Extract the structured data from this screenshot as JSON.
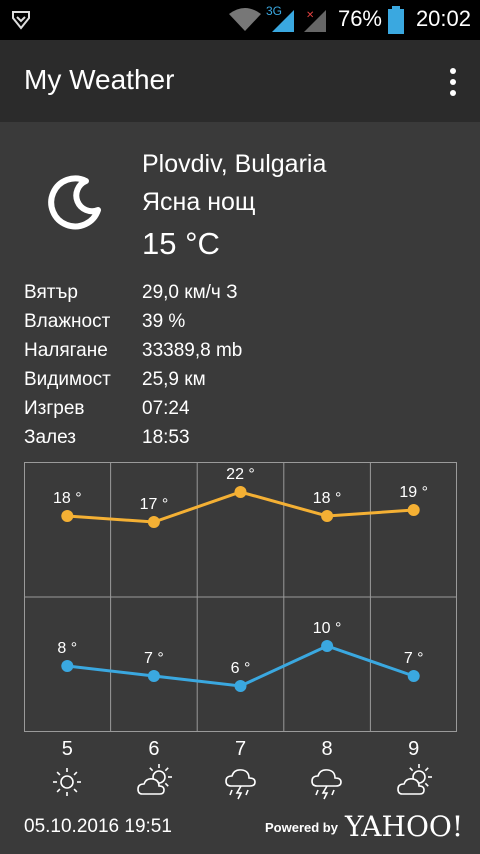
{
  "status_bar": {
    "battery_pct": "76%",
    "time": "20:02",
    "network": "3G"
  },
  "app": {
    "title": "My Weather"
  },
  "current": {
    "location": "Plovdiv, Bulgaria",
    "condition": "Ясна нощ",
    "temperature": "15 °C",
    "icon": "moon-icon"
  },
  "details": [
    {
      "label": "Вятър",
      "value": "29,0 км/ч З"
    },
    {
      "label": "Влажност",
      "value": "39 %"
    },
    {
      "label": "Налягане",
      "value": "33389,8 mb"
    },
    {
      "label": "Видимост",
      "value": "25,9 км"
    },
    {
      "label": "Изгрев",
      "value": "07:24"
    },
    {
      "label": "Залез",
      "value": "18:53"
    }
  ],
  "chart_data": {
    "type": "line",
    "categories": [
      "5",
      "6",
      "7",
      "8",
      "9"
    ],
    "series": [
      {
        "values": [
          18,
          17,
          22,
          18,
          19
        ],
        "labels": [
          "18 °",
          "17 °",
          "22 °",
          "18 °",
          "19 °"
        ],
        "color": "#F4B034"
      },
      {
        "values": [
          8,
          7,
          6,
          10,
          7
        ],
        "labels": [
          "8 °",
          "7 °",
          "6 °",
          "10 °",
          "7 °"
        ],
        "color": "#3AA8E0"
      }
    ],
    "grid": true
  },
  "forecast_days": [
    {
      "day": "5",
      "icon": "sun-icon"
    },
    {
      "day": "6",
      "icon": "partly-cloudy-icon"
    },
    {
      "day": "7",
      "icon": "thunderstorm-icon"
    },
    {
      "day": "8",
      "icon": "thunderstorm-icon"
    },
    {
      "day": "9",
      "icon": "partly-cloudy-icon"
    }
  ],
  "footer": {
    "updated": "05.10.2016 19:51",
    "powered_by": "Powered by",
    "brand": "YAHOO!"
  },
  "colors": {
    "high": "#F4B034",
    "low": "#3AA8E0",
    "background": "#3a3a3a",
    "appbar": "#2b2b2b"
  }
}
